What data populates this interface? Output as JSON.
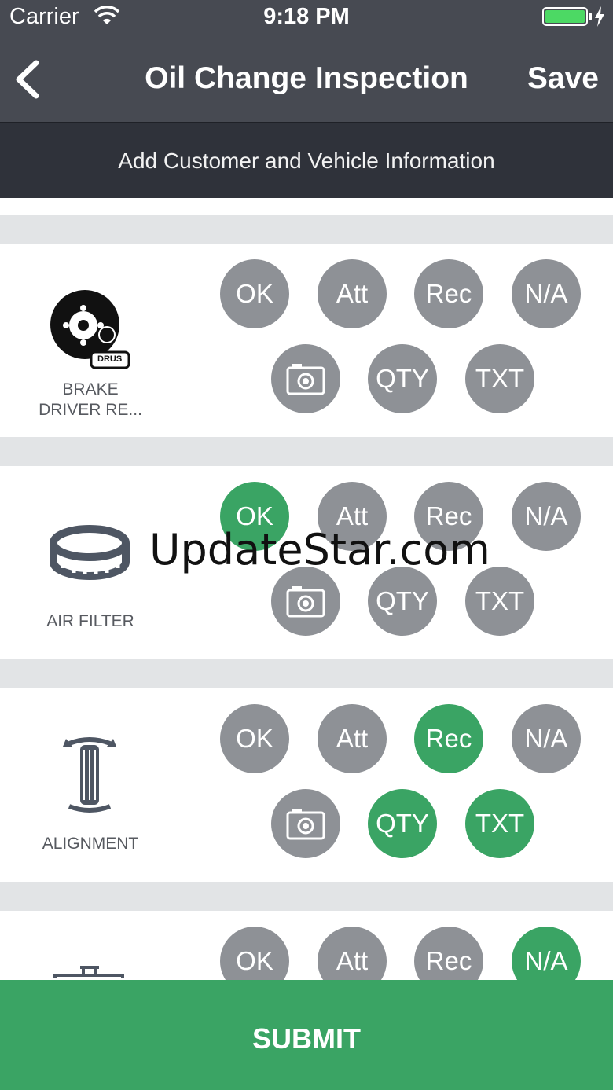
{
  "status_bar": {
    "carrier": "Carrier",
    "time": "9:18 PM"
  },
  "nav": {
    "title": "Oil Change Inspection",
    "save_label": "Save"
  },
  "subheader": "Add Customer and Vehicle Information",
  "buttons": {
    "ok": "OK",
    "att": "Att",
    "rec": "Rec",
    "na": "N/A",
    "qty": "QTY",
    "txt": "TXT",
    "photo_icon": "camera-icon"
  },
  "rows": [
    {
      "label": "BRAKE\nDRIVER RE...",
      "icon": "brake-disc-drums-icon",
      "icon_badge": "DRUS",
      "selected": []
    },
    {
      "label": "AIR FILTER",
      "icon": "air-filter-icon",
      "selected": [
        "ok"
      ]
    },
    {
      "label": "ALIGNMENT",
      "icon": "alignment-icon",
      "selected": [
        "rec",
        "qty",
        "txt"
      ]
    },
    {
      "label": "",
      "icon": "fluid-reservoir-icon",
      "selected": [
        "na"
      ]
    }
  ],
  "submit_label": "SUBMIT",
  "watermark": "UpdateStar.com",
  "colors": {
    "nav": "#474a52",
    "subheader": "#2f323a",
    "active": "#3aa464",
    "inactive": "#8e9196",
    "separator": "#e2e4e6"
  }
}
